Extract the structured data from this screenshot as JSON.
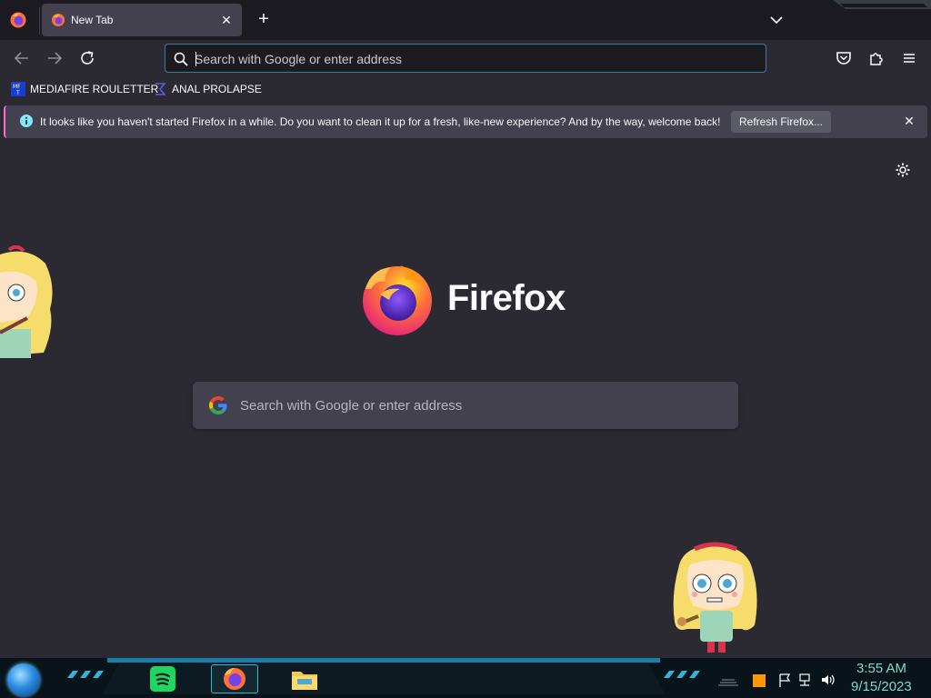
{
  "tabstrip": {
    "tabs": [
      {
        "title": "New Tab",
        "active": true
      }
    ],
    "new_tab": "+"
  },
  "navbar": {
    "urlbar": {
      "placeholder": "Search with Google or enter address",
      "value": ""
    },
    "icons": [
      "back-icon",
      "forward-icon",
      "reload-icon",
      "search-icon",
      "pocket-icon",
      "extensions-icon",
      "menu-icon"
    ]
  },
  "bookmarks": [
    {
      "label": "MEDIAFIRE ROULETTER",
      "icon": "MF T"
    },
    {
      "label": "ANAL PROLAPSE",
      "icon": "sigma-icon"
    }
  ],
  "notification": {
    "message": "It looks like you haven't started Firefox in a while. Do you want to clean it up for a fresh, like-new experience? And by the way, welcome back!",
    "button": "Refresh Firefox...",
    "accent": "#ff6bd3"
  },
  "newtab": {
    "wordmark": "Firefox",
    "search_placeholder": "Search with Google or enter address"
  },
  "taskbar": {
    "apps": [
      "spotify-icon",
      "firefox-icon",
      "file-explorer-icon"
    ],
    "active_app": "firefox",
    "clock": {
      "time": "3:55 AM",
      "date": "9/15/2023"
    },
    "accent": "#1a7fa8"
  },
  "theme": {
    "background": "#2b2a33",
    "toolbar": "#1c1b22",
    "surface": "#42414d",
    "text": "#fbfbfe"
  }
}
